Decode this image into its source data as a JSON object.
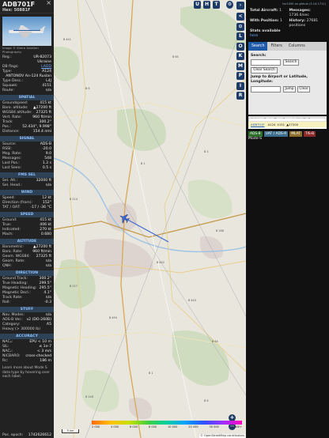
{
  "flight": {
    "callsign": "ADB701F",
    "hex_label": "Hex:",
    "hex": "50881F",
    "close": "×",
    "photo_credit": "Image © Sierra Aviation Photography"
  },
  "details": [
    {
      "k": "Reg.:",
      "v": "UR-82073"
    },
    {
      "k": "",
      "v": "Ukraine"
    },
    {
      "k": "DB flags:",
      "v": "LADD",
      "link": true
    },
    {
      "k": "Type:",
      "v": "A124"
    },
    {
      "k": "",
      "v": "ANTONOV An-124 Ruslan"
    },
    {
      "k": "Type Desc.:",
      "v": "L4J"
    },
    {
      "k": "Squawk:",
      "v": "4151"
    },
    {
      "k": "Route:",
      "v": "n/a"
    }
  ],
  "sections": [
    {
      "title": "SPATIAL",
      "rows": [
        {
          "k": "Groundspeed:",
          "v": "415 kt"
        },
        {
          "k": "Baro. altitude:",
          "v": "▲27200 ft"
        },
        {
          "k": "WGS84 altitude:",
          "v": "27325 ft"
        },
        {
          "k": "Vert. Rate:",
          "v": "960 ft/min"
        },
        {
          "k": "Track:",
          "v": "300.2°"
        },
        {
          "k": "Pos.:",
          "v": "52.434°, 9.998°"
        },
        {
          "k": "Distance:",
          "v": "154.4 nmi"
        }
      ]
    },
    {
      "title": "SIGNAL",
      "rows": [
        {
          "k": "Source:",
          "v": "ADS-B"
        },
        {
          "k": "RSSI:",
          "v": "-20.0"
        },
        {
          "k": "Msg. Rate:",
          "v": "9.0"
        },
        {
          "k": "Messages:",
          "v": "548"
        },
        {
          "k": "Last Pos.:",
          "v": "1.2 s"
        },
        {
          "k": "Last Seen:",
          "v": "0.5 s"
        }
      ]
    },
    {
      "title": "FMS SEL",
      "rows": [
        {
          "k": "Sel. Alt.:",
          "v": "32000 ft"
        },
        {
          "k": "Sel. Head.:",
          "v": "n/a"
        }
      ]
    },
    {
      "title": "WIND",
      "rows": [
        {
          "k": "Speed:",
          "v": "12 kt"
        },
        {
          "k": "Direction (from):",
          "v": "152°"
        },
        {
          "k": "TAT / OAT:",
          "v": "-17 / -36 °C"
        }
      ]
    },
    {
      "title": "SPEED",
      "rows": [
        {
          "k": "Ground:",
          "v": "415 kt"
        },
        {
          "k": "True:",
          "v": "406 kt"
        },
        {
          "k": "Indicated:",
          "v": "270 kt"
        },
        {
          "k": "Mach:",
          "v": "0.680"
        }
      ]
    },
    {
      "title": "ALTITUDE",
      "rows": [
        {
          "k": "Barometric:",
          "v": "▲27200 ft"
        },
        {
          "k": "Baro. Rate:",
          "v": "960 ft/min"
        },
        {
          "k": "Geom. WGS84:",
          "v": "27325 ft"
        },
        {
          "k": "Geom. Rate:",
          "v": "n/a"
        },
        {
          "k": "QNH:",
          "v": "n/a"
        }
      ]
    },
    {
      "title": "DIRECTION",
      "rows": [
        {
          "k": "Ground Track:",
          "v": "300.2°"
        },
        {
          "k": "True Heading:",
          "v": "299.5°"
        },
        {
          "k": "Magnetic Heading:",
          "v": "295.5°"
        },
        {
          "k": "Magnetic Decl.:",
          "v": "4.1°"
        },
        {
          "k": "Track Rate:",
          "v": "n/a"
        },
        {
          "k": "Roll:",
          "v": "-0.3"
        }
      ]
    },
    {
      "title": "STUFF",
      "rows": [
        {
          "k": "Nav. Modes:",
          "v": "n/a"
        },
        {
          "k": "ADS-B Ver.:",
          "v": "v2 (DO-260B)"
        },
        {
          "k": "Category:",
          "v": "A5"
        },
        {
          "k": "Heavy (> 300000 lb)",
          "v": ""
        }
      ]
    },
    {
      "title": "ACCURACY",
      "rows": [
        {
          "k": "NACₚ:",
          "v": "EPU < 10 m"
        },
        {
          "k": "SIL:",
          "v": "≤ 1e-7"
        },
        {
          "k": "NACᵥ:",
          "v": "< 3 m/s"
        },
        {
          "k": "NICBARO:",
          "v": "cross-checked"
        },
        {
          "k": "Rc:",
          "v": "186 m"
        }
      ]
    }
  ],
  "learn_more": "Learn more about Mode S data type by hovering over each label.",
  "epoch": {
    "k": "Pos. epoch:",
    "v": "1742626612"
  },
  "top_buttons": [
    "U",
    "H",
    "T"
  ],
  "side_buttons": [
    "<",
    "⊙",
    "L",
    "O",
    "K",
    "M",
    "P",
    "I",
    "R"
  ],
  "right": {
    "top_link": "tar1090 on github (3.14.1711)",
    "total_aircraft_label": "Total Aircraft:",
    "total_aircraft": "1",
    "messages_label": "Messages:",
    "messages": "1736.6/sec",
    "with_position_label": "With Position:",
    "with_position": "1",
    "history_label": "History:",
    "history": "27681 positions",
    "stats_label": "Stats available",
    "donate": "here",
    "tabs": [
      "Search",
      "Filters",
      "Columns"
    ],
    "search_label": "Search:",
    "search_button": "Search",
    "clear_search": "Clear Search",
    "jump_label": "Jump to Airport or Latitude, Longitude:",
    "jump_button": "Jump",
    "clear_button": "Clear",
    "table_head": [
      "",
      "Callsign",
      "Route",
      "Type",
      "Squawk",
      "Alt. (ft)",
      "Sp"
    ],
    "table_row": [
      "",
      "ADB701F",
      "",
      "A124",
      "4151",
      "▲27200",
      ""
    ],
    "chips": [
      {
        "label": "ADS-B",
        "color": "#2a6e2a"
      },
      {
        "label": "UAT / ADS-R",
        "color": "#3b6e8c"
      },
      {
        "label": "MLAT",
        "color": "#8c6e2a"
      },
      {
        "label": "TIS-B",
        "color": "#8c2a2a"
      }
    ],
    "mode_s": "Mode-S"
  },
  "map": {
    "labels": [
      "B 441",
      "B 6",
      "B 65",
      "B 1",
      "B 3",
      "B 214",
      "B 188",
      "B 442",
      "B 217",
      "B 443",
      "B 494",
      "B 64",
      "B 1",
      "B 248",
      "B 6"
    ],
    "altitude_scale": [
      "2 000",
      "4 000",
      "6 000",
      "8 000",
      "10 000",
      "20 000",
      "30 000",
      "40 000+"
    ],
    "scale_label": "5 km",
    "attribution": "© OpenStreetMap contributors",
    "zoom_in": "+",
    "zoom_out": "−"
  },
  "colors": {
    "accent": "#1e3a66",
    "section": "#2e4257",
    "link": "#6fa8ff",
    "track": "#3d6ad6"
  }
}
